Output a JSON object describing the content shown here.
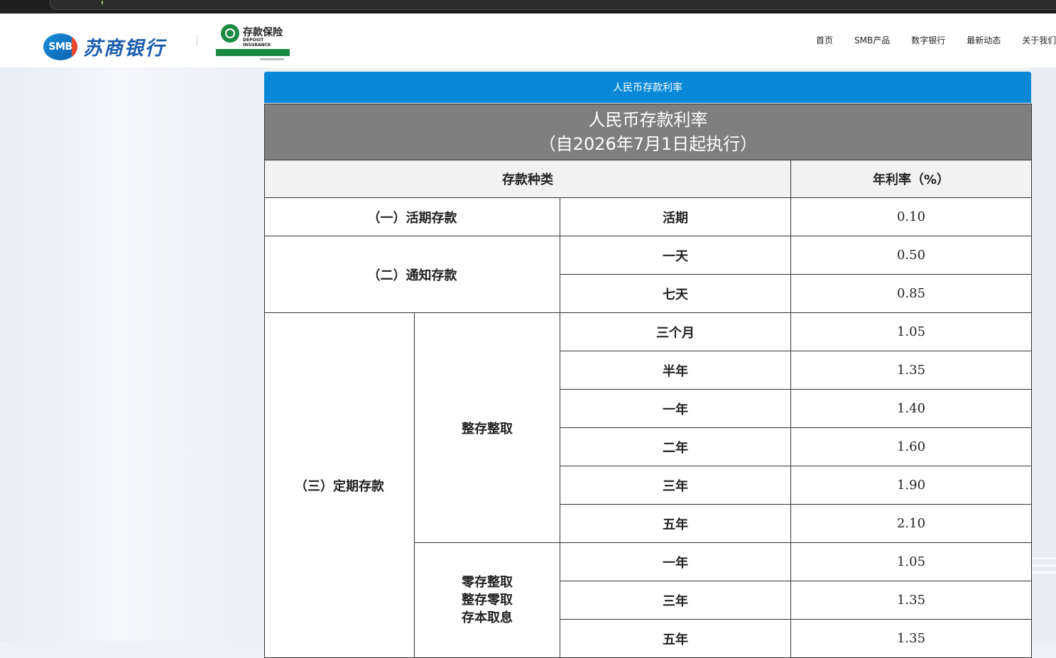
{
  "brand": {
    "badge": "SMB",
    "name": "苏商银行"
  },
  "deposit_logo": {
    "cn": "存款保险",
    "en": "DEPOSIT INSURANCE"
  },
  "nav": {
    "items": [
      "首页",
      "SMB产品",
      "数字银行",
      "最新动态",
      "关于我们"
    ]
  },
  "page": {
    "title_bar": "人民币存款利率"
  },
  "table": {
    "caption_line1": "人民币存款利率",
    "caption_line2": "（自2026年7月1日起执行）",
    "header_type": "存款种类",
    "header_rate": "年利率（%）",
    "demand": {
      "label": "（一）活期存款",
      "term": "活期",
      "rate": "0.10"
    },
    "notice": {
      "label": "（二）通知存款",
      "rows": [
        {
          "term": "一天",
          "rate": "0.50"
        },
        {
          "term": "七天",
          "rate": "0.85"
        }
      ]
    },
    "fixed": {
      "label": "（三）定期存款",
      "lump_sum": {
        "label": "整存整取",
        "rows": [
          {
            "term": "三个月",
            "rate": "1.05"
          },
          {
            "term": "半年",
            "rate": "1.35"
          },
          {
            "term": "一年",
            "rate": "1.40"
          },
          {
            "term": "二年",
            "rate": "1.60"
          },
          {
            "term": "三年",
            "rate": "1.90"
          },
          {
            "term": "五年",
            "rate": "2.10"
          }
        ]
      },
      "other": {
        "label_lines": [
          "零存整取",
          "整存零取",
          "存本取息"
        ],
        "rows": [
          {
            "term": "一年",
            "rate": "1.05"
          },
          {
            "term": "三年",
            "rate": "1.35"
          },
          {
            "term": "五年",
            "rate": "1.35"
          }
        ]
      }
    }
  }
}
